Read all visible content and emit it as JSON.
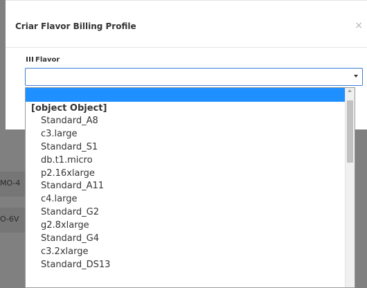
{
  "backdrop": {
    "row1": "MO-4",
    "row2": "O-6V"
  },
  "modal": {
    "title": "Criar Flavor Billing Profile",
    "close": "×",
    "field_label": "Flavor",
    "select_value": ""
  },
  "dropdown": {
    "group_label": "[object Object]",
    "options": [
      "Standard_A8",
      "c3.large",
      "Standard_S1",
      "db.t1.micro",
      "p2.16xlarge",
      "Standard_A11",
      "c4.large",
      "Standard_G2",
      "g2.8xlarge",
      "Standard_G4",
      "c3.2xlarge",
      "Standard_DS13"
    ]
  },
  "colors": {
    "highlight": "#1e90ff",
    "focus_border": "#3c7dd6",
    "backdrop": "#808080"
  }
}
